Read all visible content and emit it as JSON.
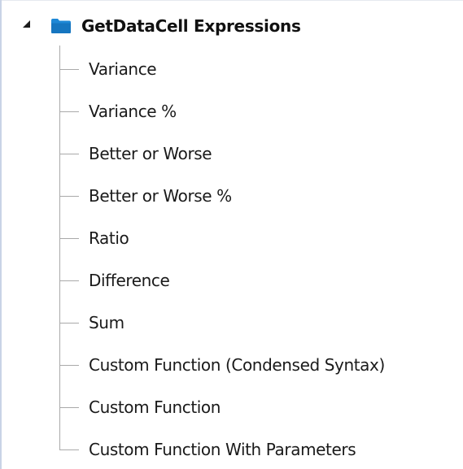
{
  "tree": {
    "root": {
      "label": "GetDataCell Expressions",
      "icon": "folder-icon",
      "expanded": true,
      "folder_color": "#1e88d6"
    },
    "children": [
      {
        "label": "Variance"
      },
      {
        "label": "Variance %"
      },
      {
        "label": "Better or Worse"
      },
      {
        "label": "Better or Worse %"
      },
      {
        "label": "Ratio"
      },
      {
        "label": "Difference"
      },
      {
        "label": "Sum"
      },
      {
        "label": "Custom Function (Condensed Syntax)"
      },
      {
        "label": "Custom Function"
      },
      {
        "label": "Custom Function With Parameters"
      }
    ]
  }
}
